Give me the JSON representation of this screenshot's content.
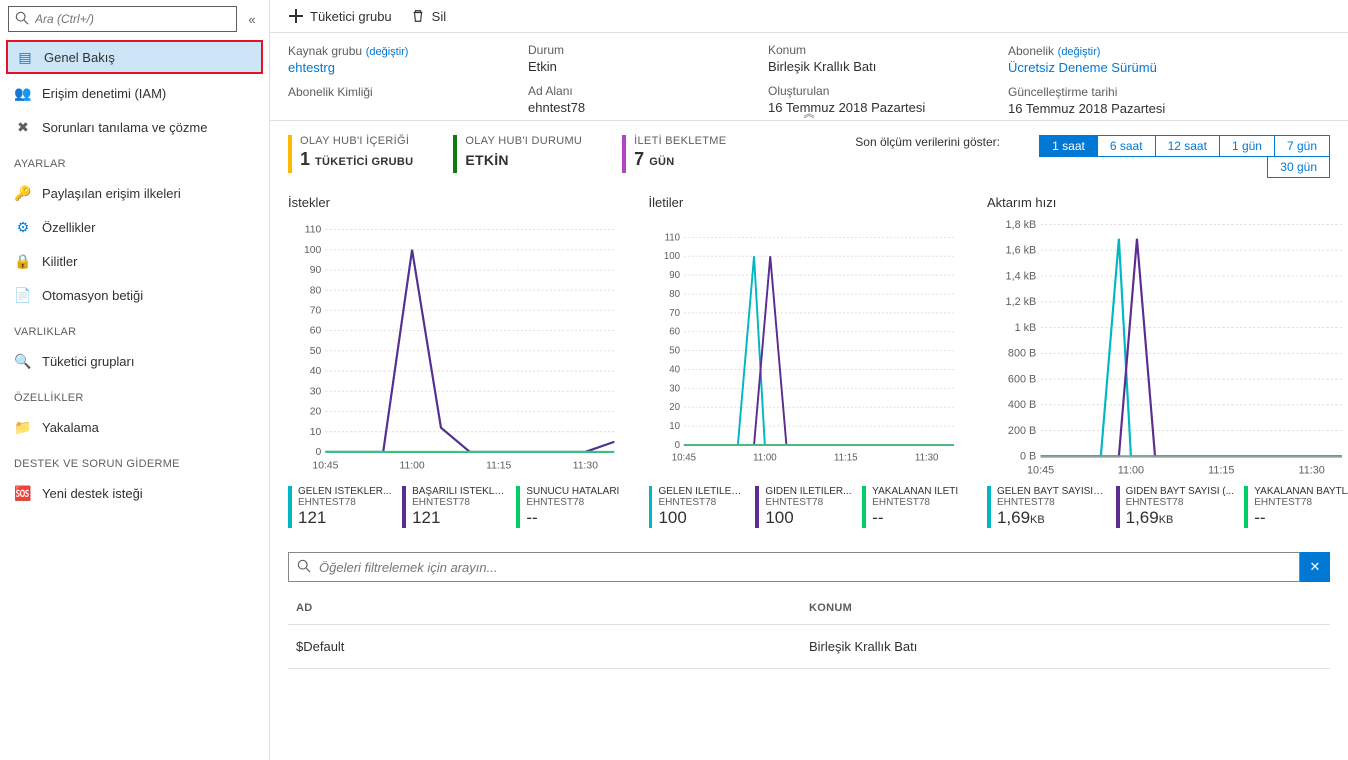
{
  "search": {
    "placeholder": "Ara (Ctrl+/)"
  },
  "nav": {
    "overview": "Genel Bakış",
    "iam": "Erişim denetimi (IAM)",
    "diagnose": "Sorunları tanılama ve çözme",
    "section_settings": "AYARLAR",
    "shared_policies": "Paylaşılan erişim ilkeleri",
    "properties": "Özellikler",
    "locks": "Kilitler",
    "automation": "Otomasyon betiği",
    "section_entities": "VARLIKLAR",
    "consumer_groups": "Tüketici grupları",
    "section_features": "ÖZELLİKLER",
    "capture": "Yakalama",
    "section_support": "DESTEK VE SORUN GİDERME",
    "new_support": "Yeni destek isteği"
  },
  "toolbar": {
    "consumer_group": "Tüketici grubu",
    "delete": "Sil"
  },
  "essentials": {
    "resource_group_label": "Kaynak grubu",
    "change": "(değiştir)",
    "resource_group_value": "ehtestrg",
    "sub_id_label": "Abonelik Kimliği",
    "status_label": "Durum",
    "status_value": "Etkin",
    "namespace_label": "Ad Alanı",
    "namespace_value": "ehntest78",
    "location_label": "Konum",
    "location_value": "Birleşik Krallık Batı",
    "created_label": "Oluşturulan",
    "created_value": "16 Temmuz 2018 Pazartesi",
    "subscription_label": "Abonelik",
    "subscription_value": "Ücretsiz Deneme Sürümü",
    "updated_label": "Güncelleştirme tarihi",
    "updated_value": "16 Temmuz 2018 Pazartesi"
  },
  "stats": {
    "content_label": "OLAY HUB'I İÇERİĞİ",
    "content_value": "1",
    "content_unit": "TÜKETİCİ GRUBU",
    "status_label": "OLAY HUB'I DURUMU",
    "status_value": "ETKİN",
    "retention_label": "İLETİ BEKLETME",
    "retention_value": "7",
    "retention_unit": "GÜN"
  },
  "time": {
    "label": "Son ölçüm verilerini göster:",
    "options": [
      "1 saat",
      "6 saat",
      "12 saat",
      "1 gün",
      "7 gün",
      "30 gün"
    ],
    "active": "1 saat"
  },
  "charts": {
    "requests": {
      "title": "İstekler",
      "metrics": [
        {
          "name": "GELEN İSTEKLER...",
          "sub": "EHNTEST78",
          "value": "121",
          "color": "#00b7c3"
        },
        {
          "name": "BAŞARILI İSTEKLER",
          "sub": "EHNTEST78",
          "value": "121",
          "color": "#5c2d91"
        },
        {
          "name": "SUNUCU HATALARI",
          "sub": "EHNTEST78",
          "value": "--",
          "color": "#00cc6a"
        }
      ]
    },
    "messages": {
      "title": "İletiler",
      "metrics": [
        {
          "name": "GELEN İLETİLER...",
          "sub": "EHNTEST78",
          "value": "100",
          "color": "#00b7c3"
        },
        {
          "name": "GİDEN İLETİLER...",
          "sub": "EHNTEST78",
          "value": "100",
          "color": "#5c2d91"
        },
        {
          "name": "YAKALANAN İLETİ",
          "sub": "EHNTEST78",
          "value": "--",
          "color": "#00cc6a"
        }
      ]
    },
    "throughput": {
      "title": "Aktarım hızı",
      "metrics": [
        {
          "name": "GELEN BAYT SAYISI (...",
          "sub": "EHNTEST78",
          "value": "1,69",
          "unit": "KB",
          "color": "#00b7c3"
        },
        {
          "name": "GİDEN BAYT SAYISI (...",
          "sub": "EHNTEST78",
          "value": "1,69",
          "unit": "KB",
          "color": "#5c2d91"
        },
        {
          "name": "YAKALANAN BAYTLAR",
          "sub": "EHNTEST78",
          "value": "--",
          "color": "#00cc6a"
        }
      ]
    }
  },
  "chart_data": [
    {
      "type": "line",
      "title": "İstekler",
      "x_ticks": [
        "10:45",
        "11:00",
        "11:15",
        "11:30"
      ],
      "y_ticks": [
        0,
        10,
        20,
        30,
        40,
        50,
        60,
        70,
        80,
        90,
        100,
        110
      ],
      "ylim": [
        0,
        110
      ],
      "series": [
        {
          "name": "GELEN İSTEKLER",
          "color": "#00b7c3",
          "points": {
            "10:45": 0,
            "10:55": 0,
            "11:00": 100,
            "11:05": 12,
            "11:10": 0,
            "11:30": 0,
            "11:35": 5
          }
        },
        {
          "name": "BAŞARILI İSTEKLER",
          "color": "#5c2d91",
          "points": {
            "10:45": 0,
            "10:55": 0,
            "11:00": 100,
            "11:05": 12,
            "11:10": 0,
            "11:30": 0,
            "11:35": 5
          }
        },
        {
          "name": "SUNUCU HATALARI",
          "color": "#00cc6a",
          "points": {
            "10:45": 0,
            "11:35": 0
          }
        }
      ]
    },
    {
      "type": "line",
      "title": "İletiler",
      "x_ticks": [
        "10:45",
        "11:00",
        "11:15",
        "11:30"
      ],
      "y_ticks": [
        0,
        10,
        20,
        30,
        40,
        50,
        60,
        70,
        80,
        90,
        100,
        110
      ],
      "ylim": [
        0,
        110
      ],
      "series": [
        {
          "name": "GELEN İLETİLER",
          "color": "#00b7c3",
          "points": {
            "10:45": 0,
            "10:55": 0,
            "10:58": 100,
            "11:00": 0,
            "11:35": 0
          }
        },
        {
          "name": "GİDEN İLETİLER",
          "color": "#5c2d91",
          "points": {
            "10:45": 0,
            "10:58": 0,
            "11:01": 100,
            "11:04": 0,
            "11:35": 0
          }
        },
        {
          "name": "YAKALANAN İLETİ",
          "color": "#00cc6a",
          "points": {
            "10:45": 0,
            "11:35": 0
          }
        }
      ]
    },
    {
      "type": "line",
      "title": "Aktarım hızı",
      "x_ticks": [
        "10:45",
        "11:00",
        "11:15",
        "11:30"
      ],
      "y_ticks_labels": [
        "0 B",
        "200 B",
        "400 B",
        "600 B",
        "800 B",
        "1 kB",
        "1,2 kB",
        "1,4 kB",
        "1,6 kB",
        "1,8 kB"
      ],
      "ylim": [
        0,
        1800
      ],
      "series": [
        {
          "name": "GELEN BAYT SAYISI",
          "color": "#00b7c3",
          "points": {
            "10:45": 0,
            "10:55": 0,
            "10:58": 1690,
            "11:00": 0,
            "11:35": 0
          }
        },
        {
          "name": "GİDEN BAYT SAYISI",
          "color": "#5c2d91",
          "points": {
            "10:45": 0,
            "10:58": 0,
            "11:01": 1690,
            "11:04": 0,
            "11:35": 0
          }
        },
        {
          "name": "YAKALANAN BAYTLAR",
          "color": "#00cc6a",
          "points": {
            "10:45": 0,
            "11:35": 0
          }
        }
      ]
    }
  ],
  "filter": {
    "placeholder": "Öğeleri filtrelemek için arayın..."
  },
  "table": {
    "col_name": "AD",
    "col_loc": "KONUM",
    "rows": [
      {
        "name": "$Default",
        "loc": "Birleşik Krallık Batı"
      }
    ]
  }
}
